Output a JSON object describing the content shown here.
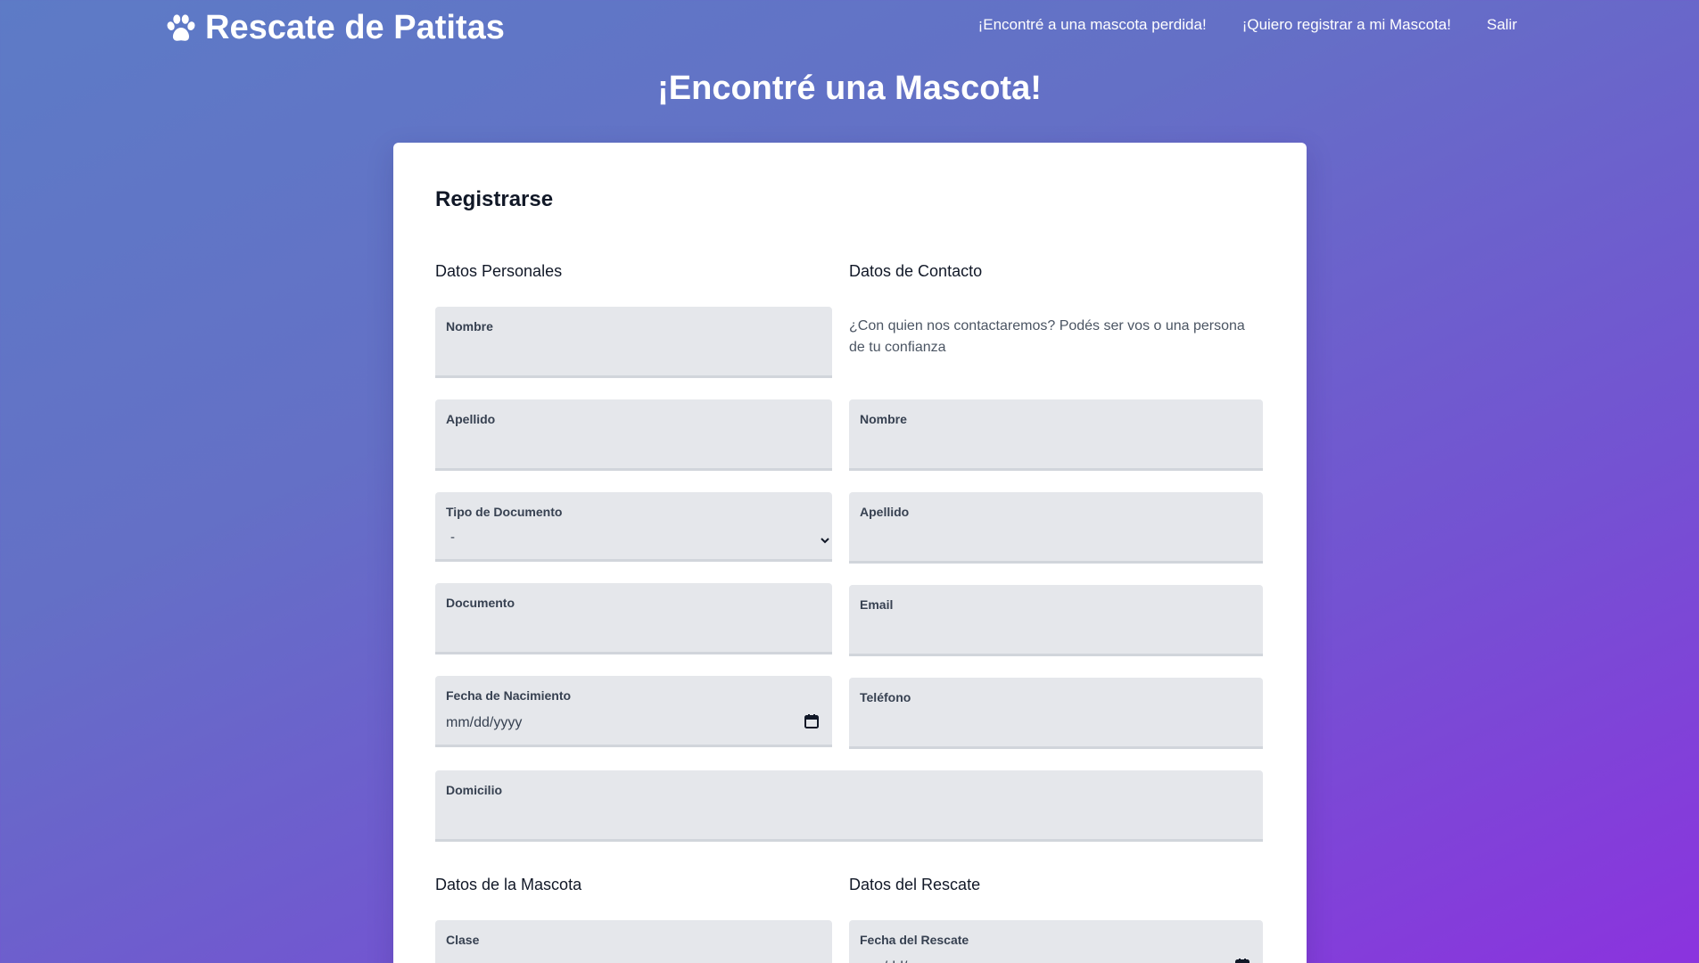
{
  "navbar": {
    "brand": "Rescate de Patitas",
    "links": [
      "¡Encontré a una mascota perdida!",
      "¡Quiero registrar a mi Mascota!",
      "Salir"
    ]
  },
  "page": {
    "title": "¡Encontré una Mascota!"
  },
  "form": {
    "title": "Registrarse",
    "personal": {
      "title": "Datos Personales",
      "nombre_label": "Nombre",
      "apellido_label": "Apellido",
      "tipo_doc_label": "Tipo de Documento",
      "tipo_doc_value": "-",
      "documento_label": "Documento",
      "fecha_nac_label": "Fecha de Nacimiento",
      "fecha_nac_placeholder": "mm/dd/yyyy",
      "domicilio_label": "Domicilio"
    },
    "contacto": {
      "title": "Datos de Contacto",
      "helper": "¿Con quien nos contactaremos? Podés ser vos o una persona de tu confianza",
      "nombre_label": "Nombre",
      "apellido_label": "Apellido",
      "email_label": "Email",
      "telefono_label": "Teléfono"
    },
    "mascota": {
      "title": "Datos de la Mascota",
      "clase_label": "Clase"
    },
    "rescate": {
      "title": "Datos del Rescate",
      "fecha_label": "Fecha del Rescate",
      "fecha_placeholder": "mm/dd/yyyy"
    }
  },
  "colors": {
    "gradient_start": "#5d7bc6",
    "gradient_end": "#8b33de",
    "field_bg": "#e5e7eb",
    "card_bg": "#ffffff"
  }
}
